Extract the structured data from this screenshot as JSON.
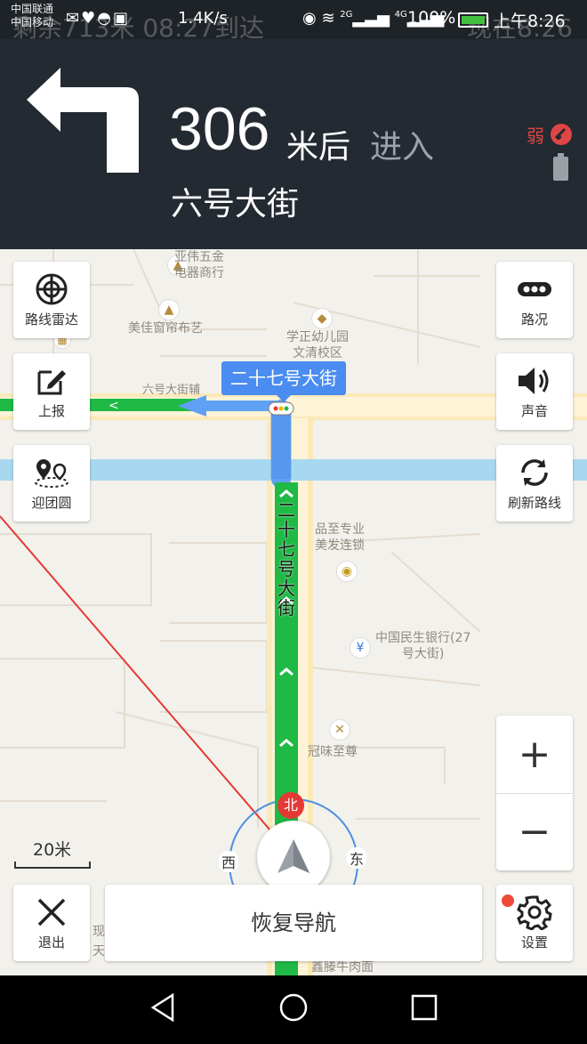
{
  "status_bar": {
    "carrier_1": "中国联通",
    "carrier_2": "中国移动",
    "ghost_left": "剩余713米 08:27到达",
    "ghost_right": "现在8:26",
    "speed": "1.4K/s",
    "net_2g": "2G",
    "net_4g": "4G",
    "battery": "100%",
    "time": "上午8:26"
  },
  "guidance": {
    "distance": "306",
    "distance_unit": "米后",
    "action": "进入",
    "next_road": "六号大街",
    "gps_signal": "弱"
  },
  "map": {
    "road_tag": "二十七号大街",
    "vertical_road": "二十七号大街",
    "horizontal_road": "六号大街辅",
    "pois": [
      {
        "name": "亚伟五金\n电器商行"
      },
      {
        "name": "美佳窗帘布艺"
      },
      {
        "name": "学正幼儿园\n文清校区"
      },
      {
        "name": "品至专业\n美发连锁"
      },
      {
        "name": "中国民生银行(27\n号大街)"
      },
      {
        "name": "冠味至尊"
      },
      {
        "name": "鑫滕牛肉面"
      },
      {
        "name": "现"
      },
      {
        "name": "天"
      }
    ],
    "scale": "20米",
    "compass": {
      "north": "北",
      "west": "西",
      "east": "东"
    }
  },
  "buttons": {
    "route_radar": "路线雷达",
    "report": "上报",
    "reunion": "迎团圆",
    "traffic": "路况",
    "sound": "声音",
    "refresh_route": "刷新路线",
    "zoom_in": "+",
    "zoom_out": "−",
    "exit": "退出",
    "resume_nav": "恢复导航",
    "settings": "设置"
  },
  "colors": {
    "header_bg": "#232a31",
    "route_green": "#1fb945",
    "route_blue": "#5fa1f5",
    "river": "#a8d8f0",
    "accent_red": "#e53935"
  }
}
